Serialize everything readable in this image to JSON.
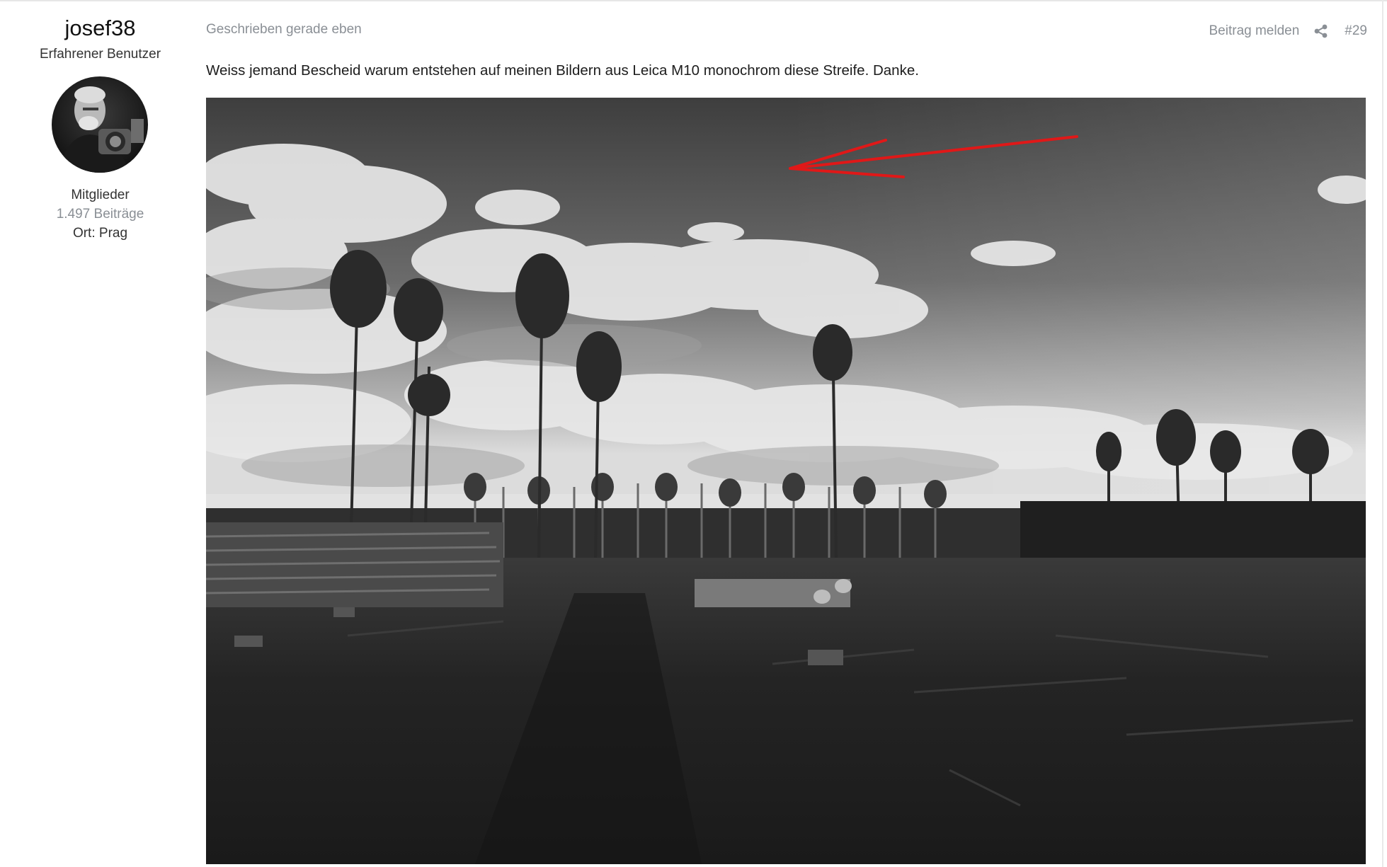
{
  "author": {
    "name": "josef38",
    "title": "Erfahrener Benutzer",
    "group": "Mitglieder",
    "posts": "1.497 Beiträge",
    "location": "Ort: Prag",
    "avatar_icon": "user-photo-avatar"
  },
  "post": {
    "meta": "Geschrieben gerade eben",
    "report_label": "Beitrag melden",
    "share_icon": "share-icon",
    "number": "#29",
    "body": "Weiss jemand Bescheid warum entstehen auf meinen Bildern aus Leica M10 monochrom diese Streife. Danke.",
    "image": {
      "description_icon": "black-and-white-forest-photo",
      "annotation_color": "#e01818"
    }
  }
}
